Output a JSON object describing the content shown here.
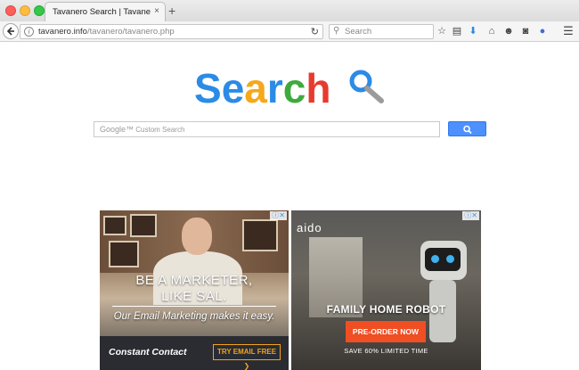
{
  "browser": {
    "tab_title": "Tavanero Search | Tavanero se…",
    "tab_close": "×",
    "new_tab": "+",
    "url_host": "tavanero.info",
    "url_path": "/tavanero/tavanero.php",
    "search_placeholder": "Search",
    "toolbar_icons": [
      "star-icon",
      "reading-list-icon",
      "download-icon",
      "home-icon",
      "chat-icon",
      "pocket-icon",
      "globe-icon",
      "menu-icon"
    ]
  },
  "page": {
    "logo_letters": [
      {
        "char": "S",
        "color": "#2b8be6"
      },
      {
        "char": "e",
        "color": "#2b8be6"
      },
      {
        "char": "a",
        "color": "#f4a81c"
      },
      {
        "char": "r",
        "color": "#2b8be6"
      },
      {
        "char": "c",
        "color": "#3daa3d"
      },
      {
        "char": "h",
        "color": "#e83a2e"
      }
    ],
    "google_search": {
      "brand": "Google™",
      "placeholder": "Custom Search"
    }
  },
  "ads": {
    "left": {
      "headline_1": "BE A MARKETER,",
      "headline_2": "LIKE SAL.",
      "subline": "Our Email Marketing makes it easy.",
      "brand": "Constant Contact",
      "cta": "TRY EMAIL FREE ❯"
    },
    "right": {
      "brand": "aido",
      "headline": "FAMILY HOME ROBOT",
      "cta": "PRE-ORDER NOW",
      "sale": "SAVE 60% LIMITED TIME"
    },
    "adchoices_label": "ⓘ✕"
  },
  "colors": {
    "accent_blue": "#4d90fe",
    "cta_orange": "#f04e23",
    "cta_gold": "#f3a31b"
  }
}
